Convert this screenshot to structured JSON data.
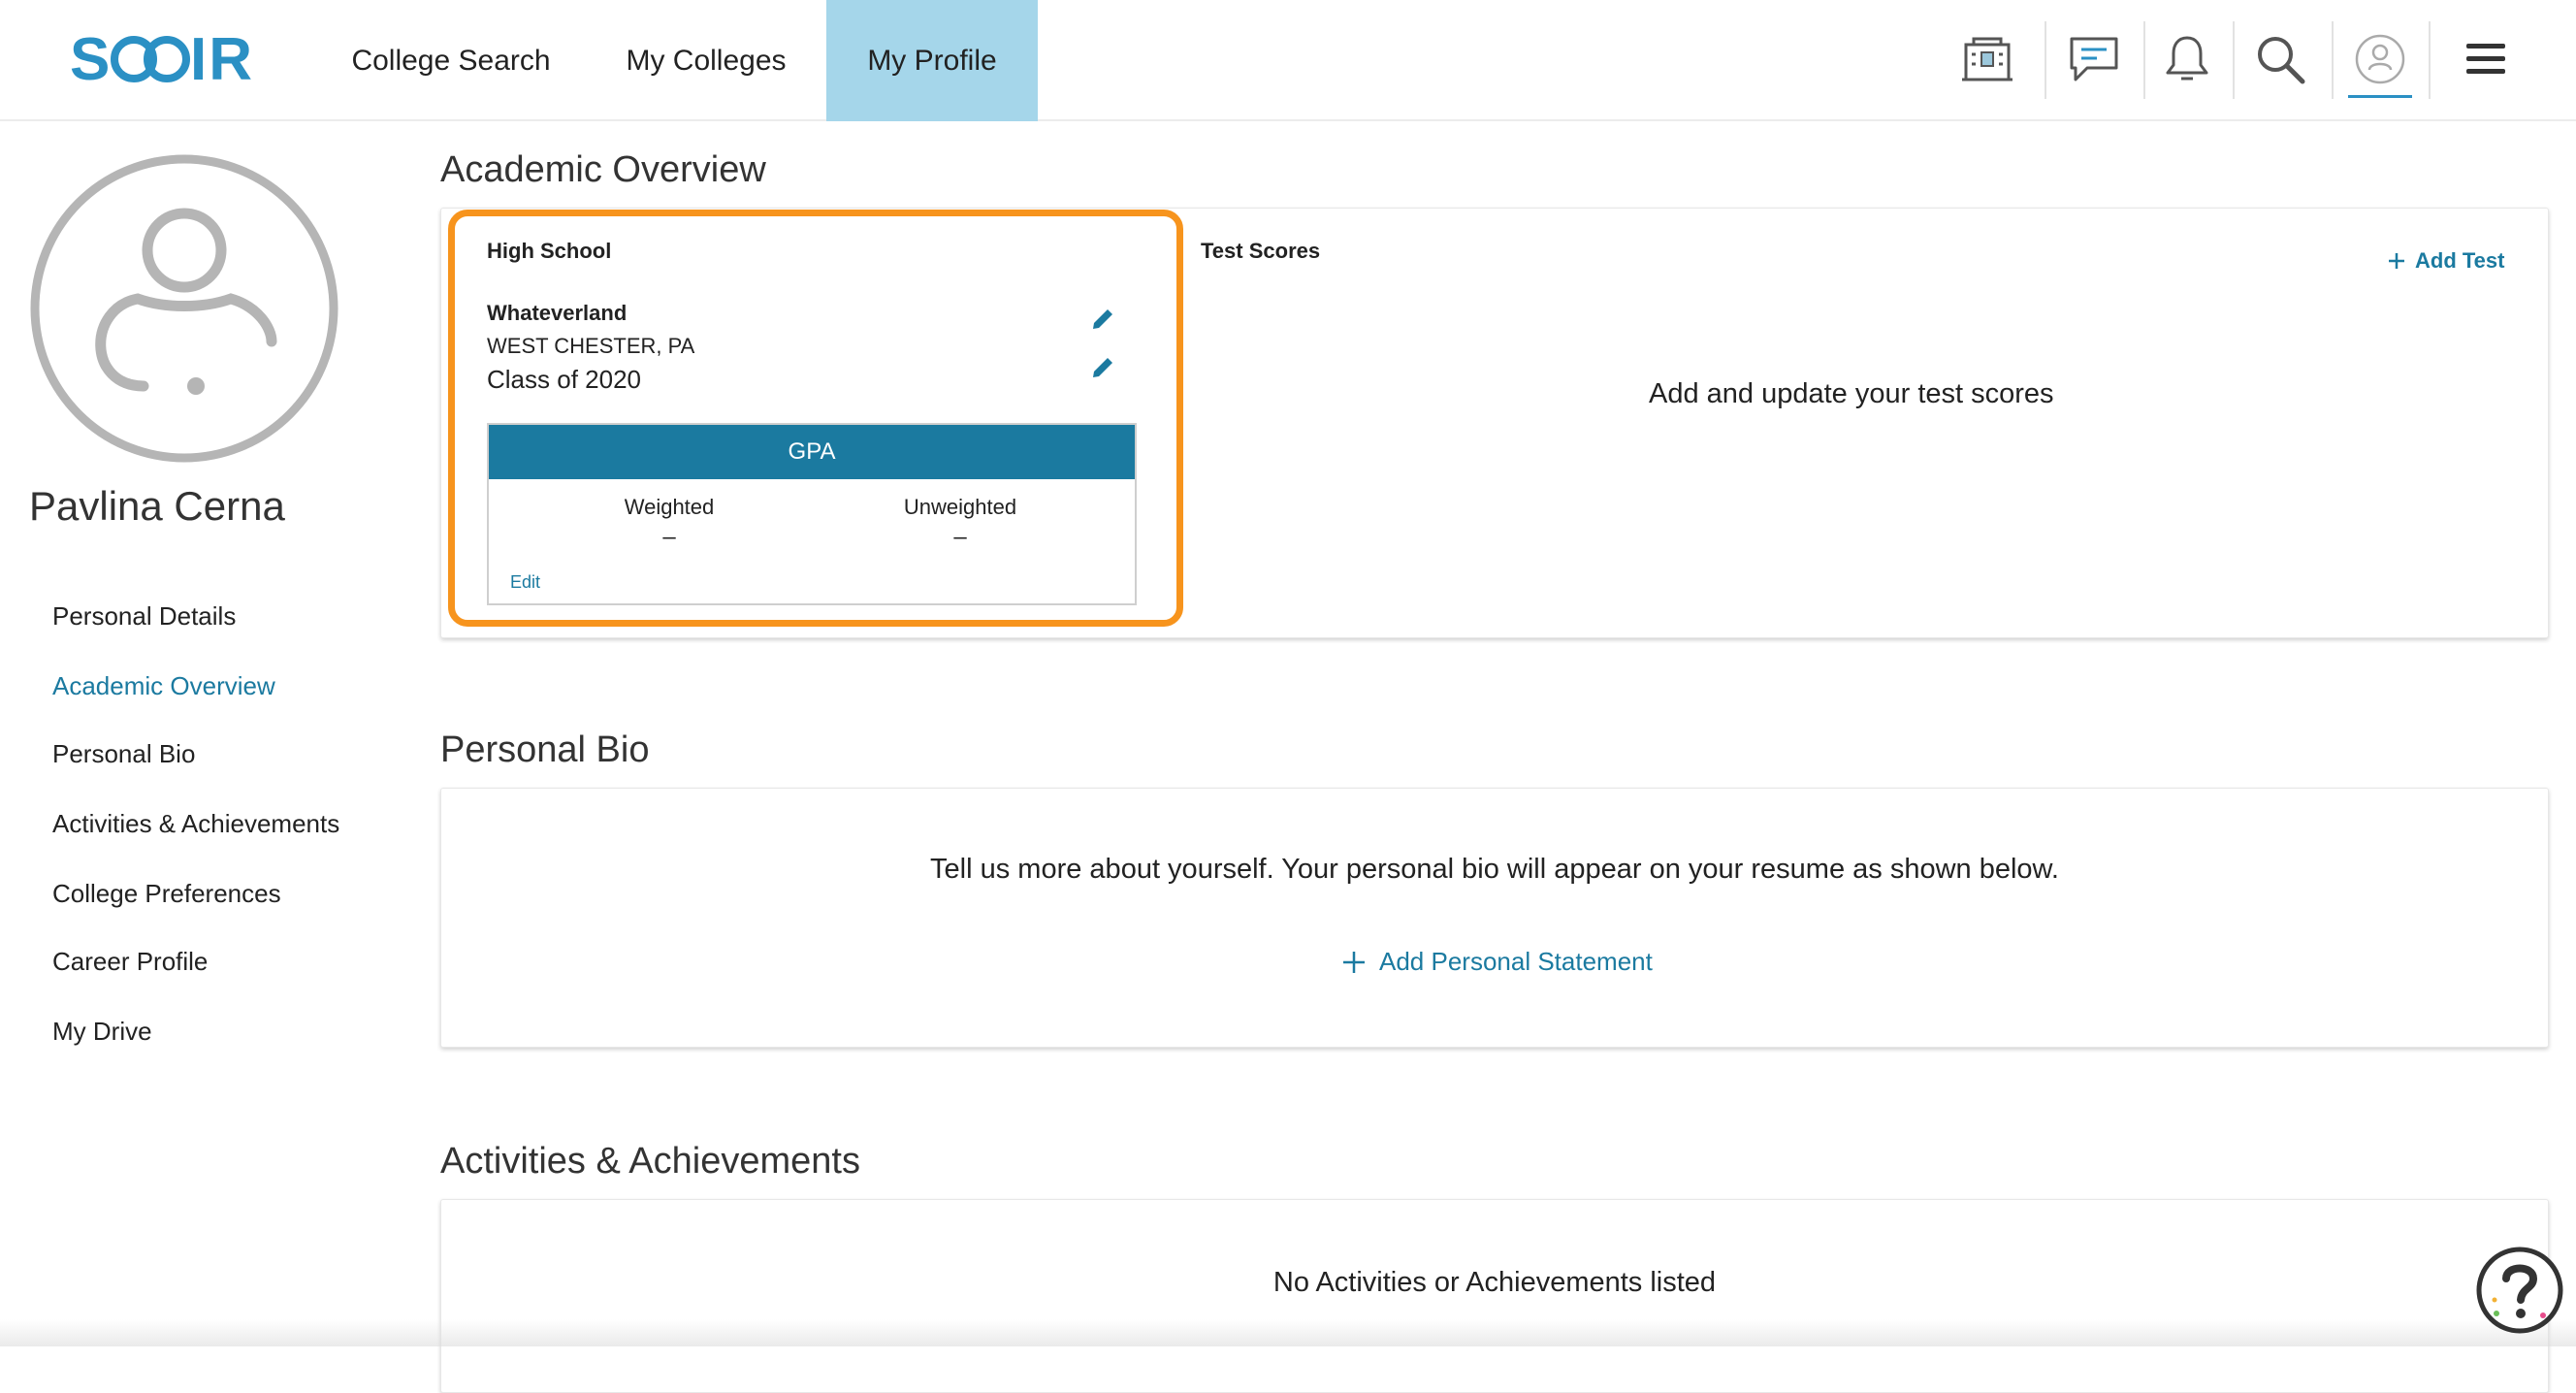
{
  "header": {
    "logo_text": "SCOIR",
    "tabs": [
      {
        "label": "College Search"
      },
      {
        "label": "My Colleges"
      },
      {
        "label": "My Profile",
        "active": true
      }
    ],
    "icons": [
      "college-building-icon",
      "messages-icon",
      "bell-icon",
      "search-icon",
      "user-avatar-icon",
      "hamburger-menu-icon"
    ]
  },
  "sidebar": {
    "name": "Pavlina Cerna",
    "items": [
      {
        "label": "Personal Details"
      },
      {
        "label": "Academic Overview",
        "active": true
      },
      {
        "label": "Personal Bio"
      },
      {
        "label": "Activities & Achievements"
      },
      {
        "label": "College Preferences"
      },
      {
        "label": "Career Profile"
      },
      {
        "label": "My Drive"
      }
    ]
  },
  "academic": {
    "title": "Academic Overview",
    "high_school": {
      "label": "High School",
      "school": "Whateverland",
      "location": "WEST CHESTER, PA",
      "class_year": "Class of 2020",
      "gpa": {
        "header": "GPA",
        "weighted_label": "Weighted",
        "weighted_value": "–",
        "unweighted_label": "Unweighted",
        "unweighted_value": "–",
        "edit_label": "Edit"
      }
    },
    "test_scores": {
      "label": "Test Scores",
      "add_label": "Add Test",
      "empty_text": "Add and update your test scores"
    }
  },
  "bio": {
    "title": "Personal Bio",
    "text": "Tell us more about yourself. Your personal bio will appear on your resume as shown below.",
    "add_label": "Add Personal Statement"
  },
  "activities": {
    "title": "Activities & Achievements",
    "empty_text": "No Activities or Achievements listed"
  },
  "colors": {
    "brand": "#2b90c4",
    "accent": "#1b7aa0",
    "active_tab": "#a5d6ea",
    "highlight": "#f7941d"
  }
}
